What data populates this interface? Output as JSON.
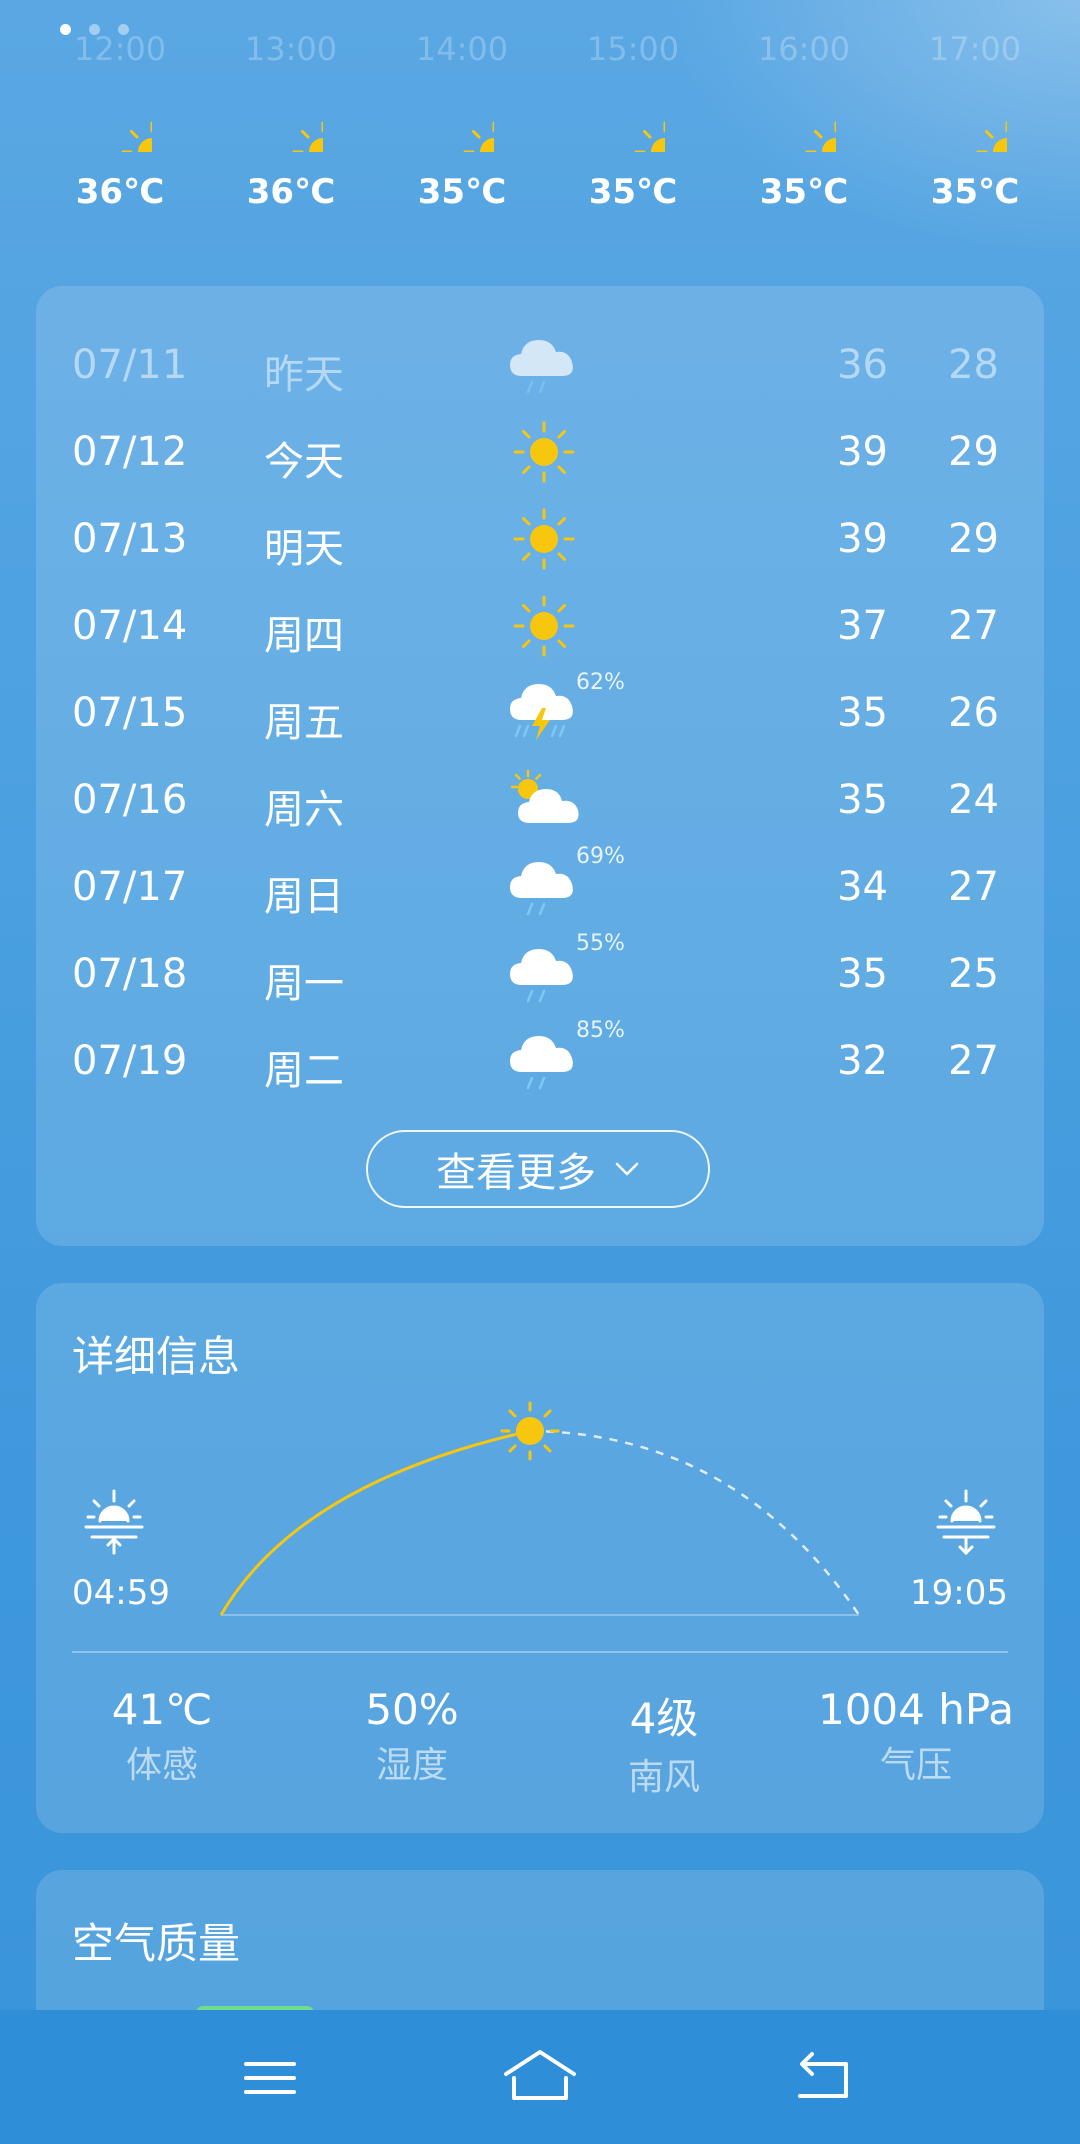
{
  "pager": {
    "count": 3,
    "active": 0
  },
  "hourly": [
    {
      "time": "12:00",
      "icon": "sun-icon",
      "temp": "36℃"
    },
    {
      "time": "13:00",
      "icon": "sun-icon",
      "temp": "36℃"
    },
    {
      "time": "14:00",
      "icon": "sun-icon",
      "temp": "35℃"
    },
    {
      "time": "15:00",
      "icon": "sun-icon",
      "temp": "35℃"
    },
    {
      "time": "16:00",
      "icon": "sun-icon",
      "temp": "35℃"
    },
    {
      "time": "17:00",
      "icon": "sun-icon",
      "temp": "35℃"
    }
  ],
  "forecast": {
    "rows": [
      {
        "date": "07/11",
        "day": "昨天",
        "icon": "cloud-rain-icon",
        "prob": "",
        "hi": "36",
        "lo": "28"
      },
      {
        "date": "07/12",
        "day": "今天",
        "icon": "sun-icon",
        "prob": "",
        "hi": "39",
        "lo": "29"
      },
      {
        "date": "07/13",
        "day": "明天",
        "icon": "sun-icon",
        "prob": "",
        "hi": "39",
        "lo": "29"
      },
      {
        "date": "07/14",
        "day": "周四",
        "icon": "sun-icon",
        "prob": "",
        "hi": "37",
        "lo": "27"
      },
      {
        "date": "07/15",
        "day": "周五",
        "icon": "thunderstorm-icon",
        "prob": "62%",
        "hi": "35",
        "lo": "26"
      },
      {
        "date": "07/16",
        "day": "周六",
        "icon": "partly-cloudy-icon",
        "prob": "",
        "hi": "35",
        "lo": "24"
      },
      {
        "date": "07/17",
        "day": "周日",
        "icon": "cloud-rain-icon",
        "prob": "69%",
        "hi": "34",
        "lo": "27"
      },
      {
        "date": "07/18",
        "day": "周一",
        "icon": "cloud-rain-icon",
        "prob": "55%",
        "hi": "35",
        "lo": "25"
      },
      {
        "date": "07/19",
        "day": "周二",
        "icon": "cloud-rain-icon",
        "prob": "85%",
        "hi": "32",
        "lo": "27"
      }
    ],
    "more_label": "查看更多"
  },
  "detail": {
    "title": "详细信息",
    "sunrise": "04:59",
    "sunset": "19:05",
    "metrics": [
      {
        "value": "41℃",
        "label": "体感"
      },
      {
        "value": "50%",
        "label": "湿度"
      },
      {
        "value": "4级",
        "label": "南风"
      },
      {
        "value": "1004 hPa",
        "label": "气压"
      }
    ]
  },
  "air_quality": {
    "title": "空气质量"
  },
  "colors": {
    "sun": "#f7c70f",
    "accent_green": "#6edc8a",
    "navbar": "#2e8ed8"
  }
}
